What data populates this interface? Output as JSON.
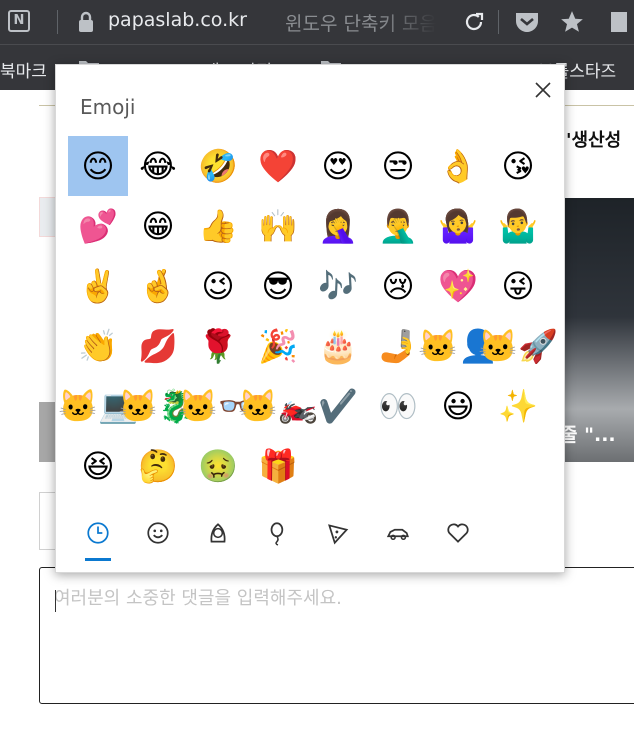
{
  "browser": {
    "tab_icon_letter": "N",
    "url": "papaslab.co.kr",
    "page_title_faded": "윈도우 단축키 모음"
  },
  "bookmarks": {
    "label": "북마크",
    "mid_text": "애쓰 관정",
    "right_label": "브롤스타즈"
  },
  "page": {
    "heading_right": "'생산성",
    "image_caption": "줄 \"...",
    "comment_placeholder": "여러분의 소중한 댓글을 입력해주세요."
  },
  "emoji_panel": {
    "title": "Emoji",
    "emojis": [
      {
        "char": "😊",
        "name": "smiling-face"
      },
      {
        "char": "😂",
        "name": "tears-of-joy"
      },
      {
        "char": "🤣",
        "name": "rolling-on-floor-laughing"
      },
      {
        "char": "❤️",
        "name": "red-heart"
      },
      {
        "char": "😍",
        "name": "heart-eyes"
      },
      {
        "char": "😒",
        "name": "unamused-face"
      },
      {
        "char": "👌",
        "name": "ok-hand"
      },
      {
        "char": "😘",
        "name": "blowing-kiss"
      },
      {
        "char": "💕",
        "name": "two-hearts"
      },
      {
        "char": "😁",
        "name": "beaming-face"
      },
      {
        "char": "👍",
        "name": "thumbs-up"
      },
      {
        "char": "🙌",
        "name": "raising-hands"
      },
      {
        "char": "🤦‍♀️",
        "name": "woman-facepalming"
      },
      {
        "char": "🤦‍♂️",
        "name": "man-facepalming"
      },
      {
        "char": "🤷‍♀️",
        "name": "woman-shrugging"
      },
      {
        "char": "🤷‍♂️",
        "name": "man-shrugging"
      },
      {
        "char": "✌️",
        "name": "victory-hand"
      },
      {
        "char": "🤞",
        "name": "crossed-fingers"
      },
      {
        "char": "😉",
        "name": "winking-face"
      },
      {
        "char": "😎",
        "name": "sunglasses-face"
      },
      {
        "char": "🎶",
        "name": "musical-notes"
      },
      {
        "char": "😢",
        "name": "crying-face"
      },
      {
        "char": "💖",
        "name": "sparkling-heart"
      },
      {
        "char": "😜",
        "name": "winking-tongue-face"
      },
      {
        "char": "👏",
        "name": "clapping-hands"
      },
      {
        "char": "💋",
        "name": "kiss-mark"
      },
      {
        "char": "🌹",
        "name": "rose"
      },
      {
        "char": "🎉",
        "name": "party-popper"
      },
      {
        "char": "🎂",
        "name": "birthday-cake"
      },
      {
        "char": "🤳",
        "name": "selfie"
      },
      {
        "char": "🐱‍👤",
        "name": "ninja-cat"
      },
      {
        "char": "🐱‍🚀",
        "name": "astro-cat"
      },
      {
        "char": "🐱‍💻",
        "name": "hacker-cat"
      },
      {
        "char": "🐱‍🐉",
        "name": "dino-cat"
      },
      {
        "char": "🐱‍👓",
        "name": "hipster-cat"
      },
      {
        "char": "🐱‍🏍",
        "name": "stunt-cat"
      },
      {
        "char": "✔️",
        "name": "check-mark"
      },
      {
        "char": "👀",
        "name": "eyes"
      },
      {
        "char": "😃",
        "name": "grinning-face"
      },
      {
        "char": "✨",
        "name": "sparkles"
      },
      {
        "char": "😆",
        "name": "squinting-face"
      },
      {
        "char": "🤔",
        "name": "thinking-face"
      },
      {
        "char": "🤢",
        "name": "nauseated-face"
      },
      {
        "char": "🎁",
        "name": "wrapped-gift"
      }
    ],
    "categories": [
      {
        "name": "recent",
        "icon": "clock-icon",
        "active": true
      },
      {
        "name": "smileys",
        "icon": "smiley-icon",
        "active": false
      },
      {
        "name": "people",
        "icon": "person-icon",
        "active": false
      },
      {
        "name": "celebration",
        "icon": "balloon-icon",
        "active": false
      },
      {
        "name": "food",
        "icon": "pizza-icon",
        "active": false
      },
      {
        "name": "travel",
        "icon": "car-icon",
        "active": false
      },
      {
        "name": "symbols",
        "icon": "heart-icon",
        "active": false
      }
    ],
    "colors": {
      "selected_bg": "#9ec5f0",
      "active_category": "#0b79d0"
    }
  }
}
